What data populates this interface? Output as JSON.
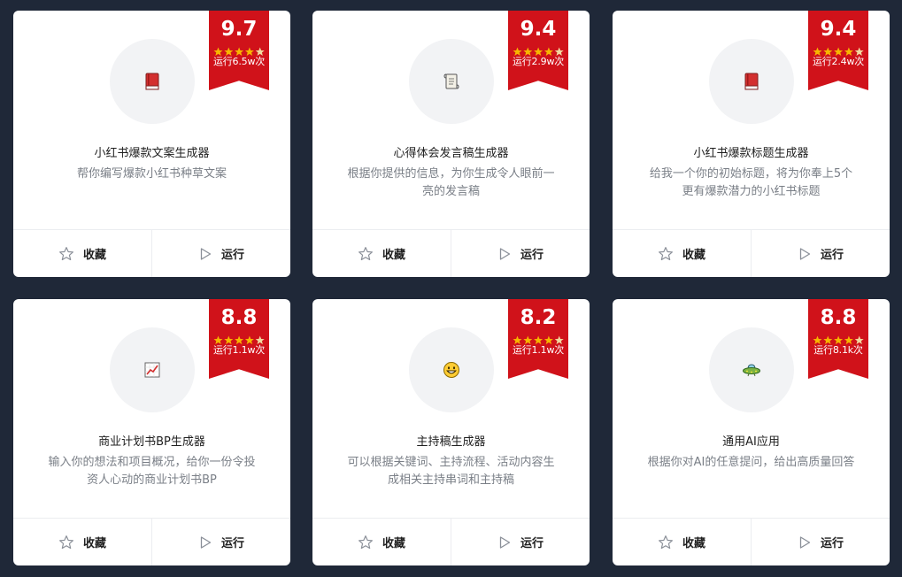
{
  "colors": {
    "background": "#1f2838",
    "badge": "#d0121a",
    "star": "#f7b500"
  },
  "labels": {
    "collect": "收藏",
    "run": "运行"
  },
  "cards": [
    {
      "title": "小红书爆款文案生成器",
      "description": "帮你编写爆款小红书种草文案",
      "score": "9.7",
      "runs": "运行6.5w次",
      "rating": 4.5,
      "icon": "red-book-icon"
    },
    {
      "title": "心得体会发言稿生成器",
      "description": "根据你提供的信息，为你生成令人眼前一亮的发言稿",
      "score": "9.4",
      "runs": "运行2.9w次",
      "rating": 4.5,
      "icon": "scroll-icon"
    },
    {
      "title": "小红书爆款标题生成器",
      "description": "给我一个你的初始标题，将为你奉上5个更有爆款潜力的小红书标题",
      "score": "9.4",
      "runs": "运行2.4w次",
      "rating": 4.5,
      "icon": "red-book-icon"
    },
    {
      "title": "商业计划书BP生成器",
      "description": "输入你的想法和项目概况，给你一份令投资人心动的商业计划书BP",
      "score": "8.8",
      "runs": "运行1.1w次",
      "rating": 4.5,
      "icon": "chart-increasing-icon"
    },
    {
      "title": "主持稿生成器",
      "description": "可以根据关键词、主持流程、活动内容生成相关主持串词和主持稿",
      "score": "8.2",
      "runs": "运行1.1w次",
      "rating": 4.5,
      "icon": "grinning-face-icon"
    },
    {
      "title": "通用AI应用",
      "description": "根据你对AI的任意提问，给出高质量回答",
      "score": "8.8",
      "runs": "运行8.1k次",
      "rating": 4.5,
      "icon": "flying-saucer-icon"
    }
  ]
}
